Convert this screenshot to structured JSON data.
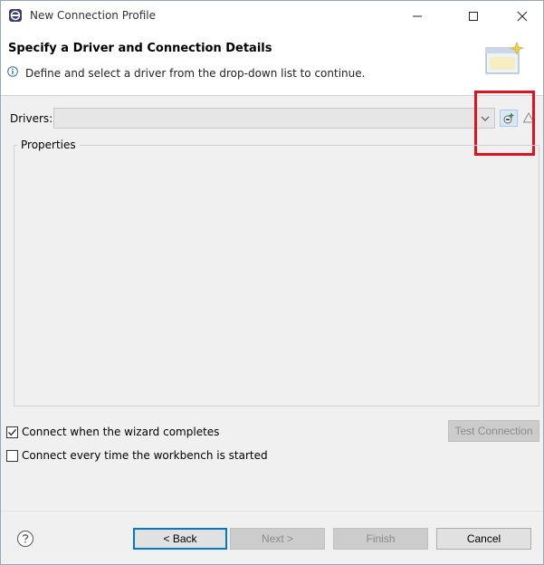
{
  "window": {
    "title": "New Connection Profile"
  },
  "header": {
    "title": "Specify a Driver and Connection Details",
    "description": "Define and select a driver from the drop-down list to continue."
  },
  "drivers": {
    "label": "Drivers:",
    "selected_value": ""
  },
  "properties": {
    "label": "Properties"
  },
  "options": {
    "connect_when_complete": {
      "label": "Connect when the wizard completes",
      "checked": true
    },
    "connect_every_time": {
      "label": "Connect every time the workbench is started",
      "checked": false
    }
  },
  "buttons": {
    "test_connection": "Test Connection",
    "back": "< Back",
    "next": "Next >",
    "finish": "Finish",
    "cancel": "Cancel"
  },
  "colors": {
    "highlight": "#e0141e",
    "accent": "#0078d7"
  }
}
